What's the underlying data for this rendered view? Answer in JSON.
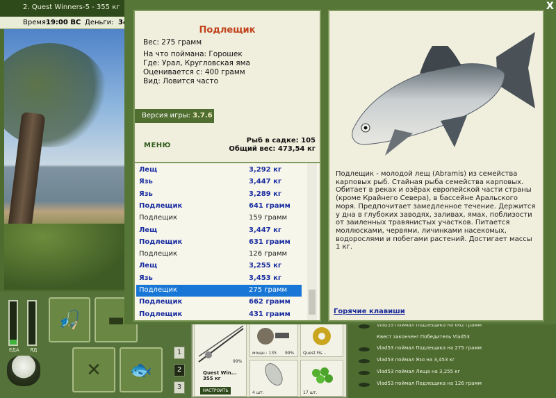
{
  "window": {
    "title": "2. Quest Winners-5 - 355 кг"
  },
  "infobar": {
    "time_label": "Время:",
    "time_value": "19:00 ВС",
    "money_label": "Деньги:",
    "money_value": "34"
  },
  "gauges": [
    {
      "label": "ЕДА",
      "level": 0.12
    },
    {
      "label": "ЯД",
      "level": 0.0
    }
  ],
  "tabs": [
    "1",
    "2",
    "3"
  ],
  "active_tab": "2",
  "slots": {
    "rod_caption": "Quest Win... 355 кг",
    "rod_percent": "99%",
    "set_button": "НАСТРОИТЬ",
    "reel_caption": "мощн.: 135",
    "reel_percent": "99%",
    "line_caption": "Quest Fis...",
    "hook_caption": "4 шт.",
    "bait_caption": "17 шт."
  },
  "feed": [
    "Vlad53 поймал Подлещика на 662 грамм",
    "Квест закончен! Победитель Vlad53",
    "Vlad53 поймал Подлещика на 275 грамм",
    "Vlad53 поймал Язя на 3,453 кг",
    "Vlad53 поймал Леща на 3,255 кг",
    "Vlad53 поймал Подлещика на 126 грамм"
  ],
  "dialog": {
    "close_label": "X",
    "fish": {
      "name": "Подлещик",
      "weight": "Вес: 275 грамм",
      "bait": "На что поймана: Горошек",
      "place": "Где: Урал, Кругловская яма",
      "valued_from": "Оценивается с: 400 грамм",
      "kind": "Вид: Ловится часто"
    },
    "version_label": "Версия игры:",
    "version_value": "3.7.6",
    "menu_label": "МЕНЮ",
    "fish_count": "Рыб в садке: 105",
    "total_weight": "Общий вес: 473,54 кг",
    "catch_list": [
      {
        "name": "Лещ",
        "weight": "3,292 кг",
        "style": "bold"
      },
      {
        "name": "Язь",
        "weight": "3,447 кг",
        "style": "bold"
      },
      {
        "name": "Язь",
        "weight": "3,289 кг",
        "style": "bold"
      },
      {
        "name": "Подлещик",
        "weight": "641 грамм",
        "style": "bold"
      },
      {
        "name": "Подлещик",
        "weight": "159 грамм",
        "style": "plain"
      },
      {
        "name": "Лещ",
        "weight": "3,447 кг",
        "style": "bold"
      },
      {
        "name": "Подлещик",
        "weight": "631 грамм",
        "style": "bold"
      },
      {
        "name": "Подлещик",
        "weight": "126 грамм",
        "style": "plain"
      },
      {
        "name": "Лещ",
        "weight": "3,255 кг",
        "style": "bold"
      },
      {
        "name": "Язь",
        "weight": "3,453 кг",
        "style": "bold"
      },
      {
        "name": "Подлещик",
        "weight": "275 грамм",
        "style": "selected"
      },
      {
        "name": "Подлещик",
        "weight": "662 грамм",
        "style": "bold"
      },
      {
        "name": "Подлещик",
        "weight": "431 грамм",
        "style": "bold"
      }
    ],
    "description": "Подлещик - молодой лещ (Abramis) из семейства карповых рыб. Стайная рыба семейства карповых. Обитает в реках и озёрах европейской части страны (кроме Крайнего Севера), в бассейне Аральского моря. Предпочитает замедленное течение. Держится у дна в глубоких заводях, заливах, ямах, поблизости от заиленных травянистых участков. Питается моллюсками, червями, личинками насекомых, водорослями и побегами растений. Достигает массы 1 кг.",
    "hotkeys_label": "Горячие клавиши"
  }
}
